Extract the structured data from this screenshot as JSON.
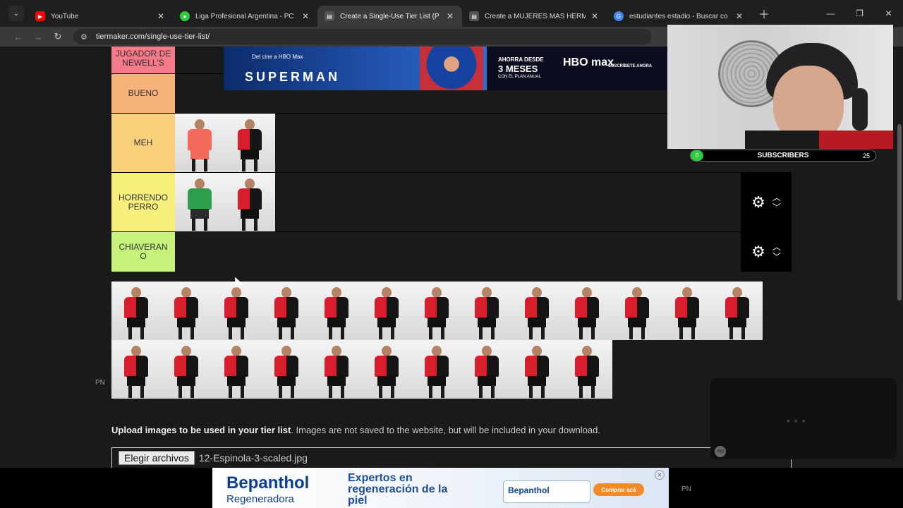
{
  "browser": {
    "tabs": [
      {
        "title": "YouTube",
        "favicon": "youtube-icon",
        "color": "#ff0000"
      },
      {
        "title": "Liga Profesional Argentina - PC",
        "favicon": "soccer-icon",
        "color": "#2ecc40"
      },
      {
        "title": "Create a Single-Use Tier List (P",
        "favicon": "tiermaker-icon",
        "color": "#444444",
        "active": true
      },
      {
        "title": "Create a MUJERES MAS HERMO",
        "favicon": "tiermaker-icon",
        "color": "#444444"
      },
      {
        "title": "estudiantes estadio - Buscar co",
        "favicon": "google-icon",
        "color": "#4285f4"
      }
    ],
    "url": "tiermaker.com/single-use-tier-list/"
  },
  "tiers": [
    {
      "label": "JUGADOR DE NEWELL'S",
      "color": "#f47a8a",
      "players": 0
    },
    {
      "label": "BUENO",
      "color": "#f6b27b",
      "players": 0
    },
    {
      "label": "MEH",
      "color": "#f8cf7b",
      "players": 2,
      "kits": [
        "gk-orange",
        "home"
      ]
    },
    {
      "label": "HORRENDO PERRO",
      "color": "#f7ef7b",
      "players": 2,
      "kits": [
        "gk-green",
        "home"
      ]
    },
    {
      "label": "CHIAVERAN O",
      "color": "#c6f27b",
      "players": 0
    }
  ],
  "ads": {
    "top_small": "Del cine a HBO Max",
    "top_title": "SUPERMAN",
    "hbo_l1": "AHORRA DESDE",
    "hbo_l2": "3 MESES",
    "hbo_l3": "CON EL PLAN ANUAL",
    "hbo_logo": "HBO max",
    "hbo_cta": "SUSCRÍBETE AHORA",
    "bottom_brand": "Bepanthol",
    "bottom_sub": "Regeneradora",
    "bottom_slogan": "Expertos en regeneración de la piel",
    "bottom_tube": "Bepanthol",
    "bottom_cta": "Comprar acá"
  },
  "pool": {
    "row1_count": 13,
    "row2_count": 10
  },
  "pn_label": "PN",
  "upload": {
    "bold": "Upload images to be used in your tier list",
    "rest": ". Images are not saved to the website, but will be included in your download.",
    "button": "Elegir archivos",
    "filename": "12-Espinola-3-scaled.jpg"
  },
  "stream": {
    "subscribers_label": "SUBSCRIBERS",
    "subscribers_start": "0",
    "subscribers_goal": "25"
  }
}
